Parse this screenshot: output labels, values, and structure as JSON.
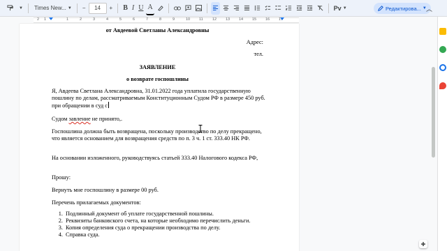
{
  "toolbar": {
    "font_name": "Times New...",
    "font_size": "14",
    "bold": "B",
    "italic": "I",
    "underline": "U",
    "text_color": "A",
    "minus": "−",
    "plus": "+",
    "editing_mode": "Редактирова..."
  },
  "ruler": {
    "numbers": [
      "2",
      "1",
      "1",
      "2",
      "3",
      "4",
      "5",
      "6",
      "7",
      "8",
      "9",
      "10",
      "11",
      "12",
      "13",
      "14",
      "15",
      "16",
      "17",
      "18"
    ]
  },
  "document": {
    "top_cut": "",
    "from_line": "от Авдеевой Светланы Александровны",
    "address": "Адрес:",
    "phone": "тел.",
    "title": "ЗАЯВЛЕНИЕ",
    "subtitle": "о возврате госпошлины",
    "p1": "Я, Авдеева Светлана Александровна,  31.01.2022 года  уплатила государственную пошлину по делам, рассматриваемым Конституционным Судом РФ в размере 450 руб. при обращении в суд с",
    "p2_start": "Судом ",
    "p2_misspelled": "завление",
    "p2_end": " не  принято,.",
    "p3": "Госпошлина должна быть возвращена, поскольку производство по делу прекращено, что является основанием для возвращения средств по п. 3 ч. 1 ст. 333.40 НК РФ.",
    "p4": "На основании изложенного, руководствуясь статьей 333.40 Налогового кодекса РФ,",
    "p5": "Прошу:",
    "p6": "Вернуть мне госпошлину в размере 00 руб.",
    "p7": "Перечень прилагаемых документов:",
    "attachments": [
      "Подлинный документ об уплате государственной пошлины.",
      "Реквизиты банковского счета, на которые необходимо перечислить деньги.",
      "Копия определения суда о прекращении производства по делу.",
      "Справка суда."
    ]
  },
  "colors": {
    "accent": "#1a73e8",
    "toolbar_bg": "#edf2fa",
    "editing_bg": "#d3e3fd",
    "spell_error": "#d93025"
  }
}
